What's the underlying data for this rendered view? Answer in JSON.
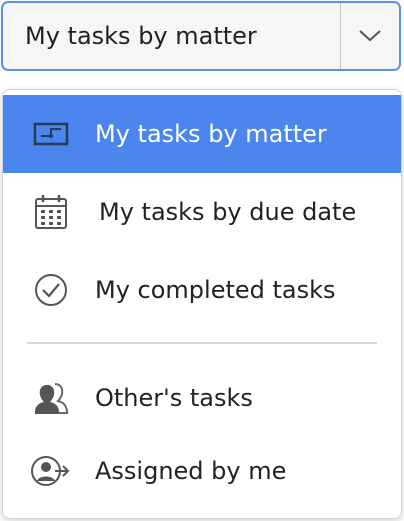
{
  "select": {
    "current_value": "My tasks by matter",
    "caret_icon": "chevron-down-icon"
  },
  "menu": {
    "items": [
      {
        "label": "My tasks by matter",
        "icon": "matter-board-icon",
        "selected": true
      },
      {
        "label": "My tasks by due date",
        "icon": "calendar-icon",
        "selected": false
      },
      {
        "label": "My completed tasks",
        "icon": "check-circle-icon",
        "selected": false
      },
      {
        "label": "Other's tasks",
        "icon": "users-icon",
        "selected": false
      },
      {
        "label": "Assigned by me",
        "icon": "user-arrow-icon",
        "selected": false
      }
    ]
  },
  "colors": {
    "accent": "#4a86ee",
    "focus_border": "#5b93e6",
    "icon_gray": "#555555"
  }
}
